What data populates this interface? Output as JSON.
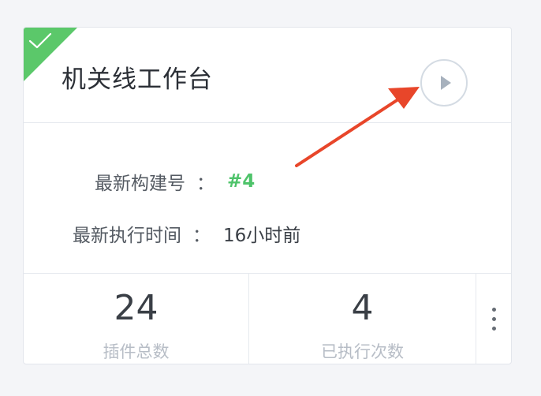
{
  "card": {
    "title": "机关线工作台",
    "status_icon": "check-icon",
    "status_color": "#5bc86a",
    "play_icon": "play-icon"
  },
  "info": {
    "build_label": "最新构建号",
    "build_value": "#4",
    "build_value_color": "#4ec36a",
    "time_label": "最新执行时间",
    "time_value": "16小时前",
    "colon": "："
  },
  "stats": [
    {
      "value": "24",
      "label": "插件总数"
    },
    {
      "value": "4",
      "label": "已执行次数"
    }
  ],
  "more_icon": "more-vertical-icon",
  "annotation": {
    "arrow_color": "#e8462a"
  }
}
